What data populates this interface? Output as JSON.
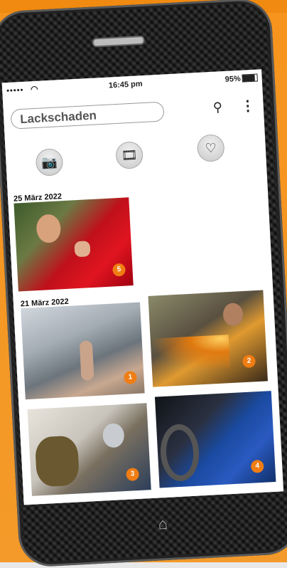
{
  "status": {
    "signal": "•••••",
    "wifi_icon": "wifi-icon",
    "time": "16:45 pm",
    "battery": "95%"
  },
  "search": {
    "value": "Lackschaden"
  },
  "toolbar": {
    "icons": [
      "camera-icon",
      "film-icon",
      "heart-icon"
    ]
  },
  "sections": [
    {
      "date": "25 März 2022",
      "photos": [
        {
          "badge": "5",
          "subject": "mechanic-thumbs-up-red-car"
        }
      ]
    },
    {
      "date": "21 März 2022",
      "photos": [
        {
          "badge": "1",
          "subject": "dented-car-finger"
        },
        {
          "badge": "2",
          "subject": "grinding-sparks"
        },
        {
          "badge": "3",
          "subject": "painter-spray-mask"
        },
        {
          "badge": "4",
          "subject": "blue-car-door-scratch"
        }
      ]
    }
  ],
  "colors": {
    "accent": "#f07d13",
    "background": "#f7941d"
  }
}
